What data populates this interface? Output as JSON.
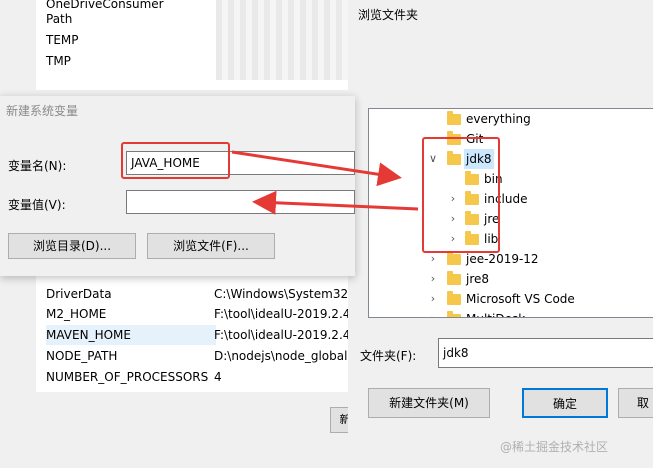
{
  "env_list_top": [
    {
      "name": "OneDriveConsumer"
    },
    {
      "name": "Path"
    },
    {
      "name": "TEMP"
    },
    {
      "name": "TMP"
    }
  ],
  "env_list_bottom": [
    {
      "name": "DriverData",
      "value": "C:\\Windows\\System32\\"
    },
    {
      "name": "M2_HOME",
      "value": "F:\\tool\\idealU-2019.2.4."
    },
    {
      "name": "MAVEN_HOME",
      "value": "F:\\tool\\idealU-2019.2.4."
    },
    {
      "name": "NODE_PATH",
      "value": "D:\\nodejs\\node_global"
    },
    {
      "name": "NUMBER_OF_PROCESSORS",
      "value": "4"
    }
  ],
  "new_var_dialog": {
    "title": "新建系统变量",
    "name_label": "变量名(N):",
    "name_value": "JAVA_HOME",
    "value_label": "变量值(V):",
    "value_value": "",
    "browse_dir_label": "浏览目录(D)...",
    "browse_file_label": "浏览文件(F)..."
  },
  "browse_dialog": {
    "title": "浏览文件夹",
    "tree": [
      {
        "name": "everything",
        "expander": ""
      },
      {
        "name": "Git",
        "expander": ""
      },
      {
        "name": "jdk8",
        "expander": "∨"
      },
      {
        "name": "bin",
        "expander": ""
      },
      {
        "name": "include",
        "expander": "›"
      },
      {
        "name": "jre",
        "expander": "›"
      },
      {
        "name": "lib",
        "expander": "›"
      },
      {
        "name": "jee-2019-12",
        "expander": "›"
      },
      {
        "name": "jre8",
        "expander": "›"
      },
      {
        "name": "Microsoft VS Code",
        "expander": "›"
      },
      {
        "name": "MultiDesk",
        "expander": "›"
      }
    ],
    "folder_label": "文件夹(F):",
    "folder_value": "jdk8",
    "new_folder_label": "新建文件夹(M)",
    "ok_label": "确定",
    "cancel_label": "取"
  },
  "background_button_label": "新",
  "watermark": "@稀土掘金技术社区",
  "colors": {
    "highlight": "#e53935",
    "folder": "#f5c84c",
    "selection": "#cce8ff"
  }
}
